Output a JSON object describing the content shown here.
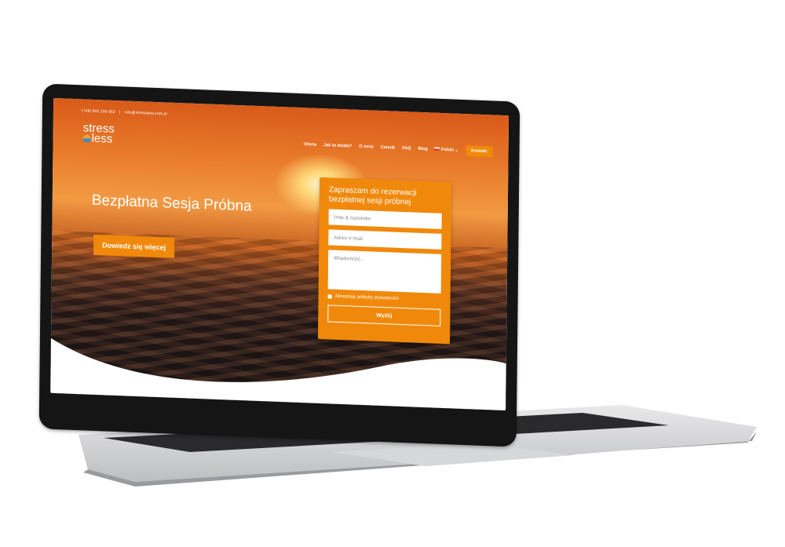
{
  "topbar": {
    "phone": "(+48) 602 156 853",
    "separator": "|",
    "email": "info@stressless.com.pl"
  },
  "logo": {
    "line1": "stress",
    "line2": "less",
    "icon": "sunset-circle-icon"
  },
  "nav": {
    "items": [
      "Oferta",
      "Jak to działa?",
      "O mnie",
      "Cennik",
      "FAQ",
      "Blog"
    ],
    "language": "Polski",
    "language_caret": "⌄",
    "contact_label": "Kontakt"
  },
  "hero": {
    "title": "Bezpłatna Sesja Próbna",
    "cta_label": "Dowiedz się więcej"
  },
  "form": {
    "title": "Zapraszam do rezerwacji bezpłatnej sesji próbnej",
    "name_placeholder": "Imię & nazwisko",
    "email_placeholder": "Adres e-mail",
    "message_placeholder": "Wiadomość...",
    "consent_label": "Akceptuję politykę prywatności",
    "submit_label": "Wyślij"
  },
  "colors": {
    "accent": "#f0890b",
    "bezel": "#151515",
    "text_light": "#ffffff"
  }
}
